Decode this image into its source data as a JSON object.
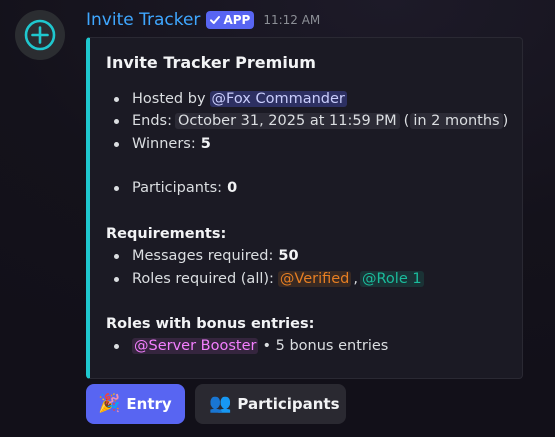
{
  "message": {
    "author": "Invite Tracker",
    "badge": "APP",
    "timestamp": "11:12 AM",
    "avatar_icon": "plus-circle-icon",
    "accent_color": "#1fc8cf"
  },
  "embed": {
    "title": "Invite Tracker Premium",
    "hosted_label": "Hosted by",
    "host_mention": "@Fox Commander",
    "ends_label": "Ends:",
    "ends_date": "October 31, 2025 at 11:59 PM",
    "ends_relative_open": "(",
    "ends_relative": "in 2 months",
    "ends_relative_close": ")",
    "winners_label": "Winners:",
    "winners_value": "5",
    "participants_label": "Participants:",
    "participants_value": "0",
    "requirements_heading": "Requirements:",
    "messages_label": "Messages required:",
    "messages_value": "50",
    "roles_label": "Roles required (all):",
    "role_verified": "@Verified",
    "role_separator": ",",
    "role_one": "@Role 1",
    "bonus_heading": "Roles with bonus entries:",
    "bonus_role": "@Server Booster",
    "bonus_suffix": "• 5 bonus entries"
  },
  "buttons": {
    "entry_emoji": "🎉",
    "entry_label": "Entry",
    "participants_emoji": "👥",
    "participants_label": "Participants"
  }
}
